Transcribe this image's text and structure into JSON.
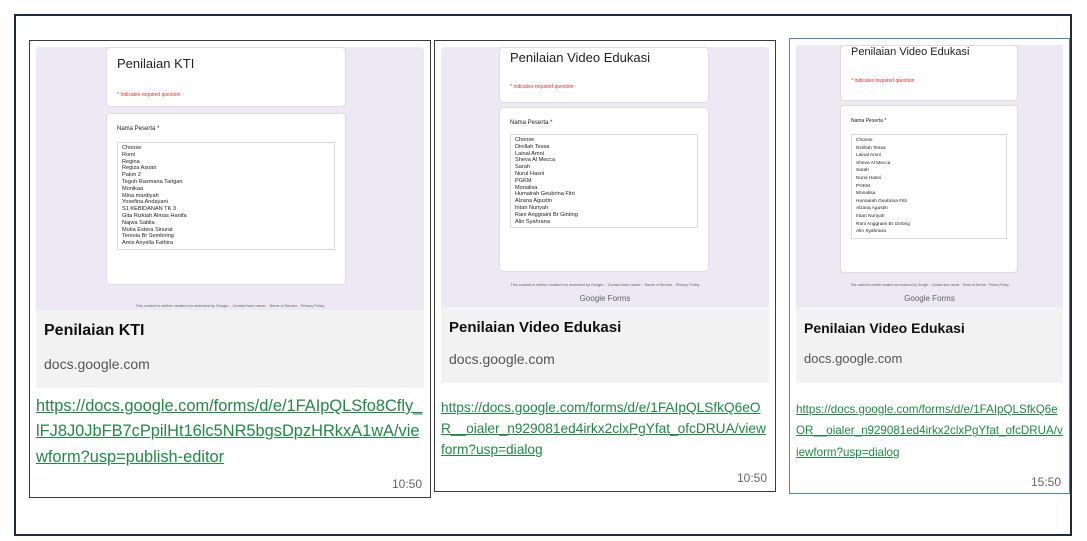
{
  "cards": [
    {
      "form_title": "Penilaian KTI",
      "required_note": "* Indicates required question",
      "question_label": "Nama Peserta *",
      "options": [
        "Choose",
        "Romi",
        "Regina",
        "Regiza Asnan",
        "Pakm 2",
        "Teguh Rasmana Tarigan",
        "Monikaa",
        "Mina mardiyah",
        "Yosefina Andayani",
        "S1 KEBIDANAN TK 3",
        "Gita Rizkiah Almas Hanifa",
        "Najwa Sabila",
        "Mutia Estera Sinurat",
        "Teresia Br Sembiring",
        "Amis Anyella Fathira"
      ],
      "footer_note": "This content is neither created nor endorsed by Google. - Contact form owner - Terms of Service - Privacy Policy",
      "brand": "",
      "title": "Penilaian KTI",
      "domain": "docs.google.com",
      "url": "https://docs.google.com/forms/d/e/1FAIpQLSfo8Cfly_lFJ8J0JbFB7cPpilHt16lc5NR5bgsDpzHRkxA1wA/viewform?usp=publish-editor",
      "time": "10:50"
    },
    {
      "form_title": "Penilaian Video Edukasi",
      "required_note": "* Indicates required question",
      "question_label": "Nama Peserta *",
      "options": [
        "Choose",
        "Dinillah Tessa",
        "Lainal Amni",
        "Sheva Al Mecca",
        "Sarah",
        "Nurul Hasni",
        "PGKM",
        "Monalisa",
        "Humairah Geubrina Fitri",
        "Alzana Agustin",
        "Intan Nuriyah",
        "Rani Anggraini Br Ginting",
        "Alin Syahrana"
      ],
      "footer_note": "This content is neither created nor endorsed by Google. - Contact form owner - Terms of Service - Privacy Policy",
      "brand": "Google Forms",
      "title": "Penilaian Video Edukasi",
      "domain": "docs.google.com",
      "url": "https://docs.google.com/forms/d/e/1FAIpQLSfkQ6eOR__oialer_n929081ed4irkx2clxPgYfat_ofcDRUA/viewform?usp=dialog",
      "time": "10:50"
    },
    {
      "form_title": "Penilaian Video Edukasi",
      "required_note": "* Indicates required question",
      "question_label": "Nama Peserta *",
      "options": [
        "Choose",
        "Dinillah Tessa",
        "Lainal Amni",
        "Sheva Al Mecca",
        "Sarah",
        "Nurul Hasni",
        "PGKM",
        "Monalisa",
        "Humairah Geubrina Fitri",
        "Alzana Agustin",
        "Intan Nuriyah",
        "Rani Anggraini Br Ginting",
        "Alin Syahrana"
      ],
      "footer_note": "This content is neither created nor endorsed by Google. - Contact form owner - Terms of Service - Privacy Policy",
      "brand": "Google Forms",
      "title": "Penilaian Video Edukasi",
      "domain": "docs.google.com",
      "url": "https://docs.google.com/forms/d/e/1FAIpQLSfkQ6eOR__oialer_n929081ed4irkx2clxPgYfat_ofcDRUA/viewform?usp=dialog",
      "time": "15:50"
    }
  ]
}
